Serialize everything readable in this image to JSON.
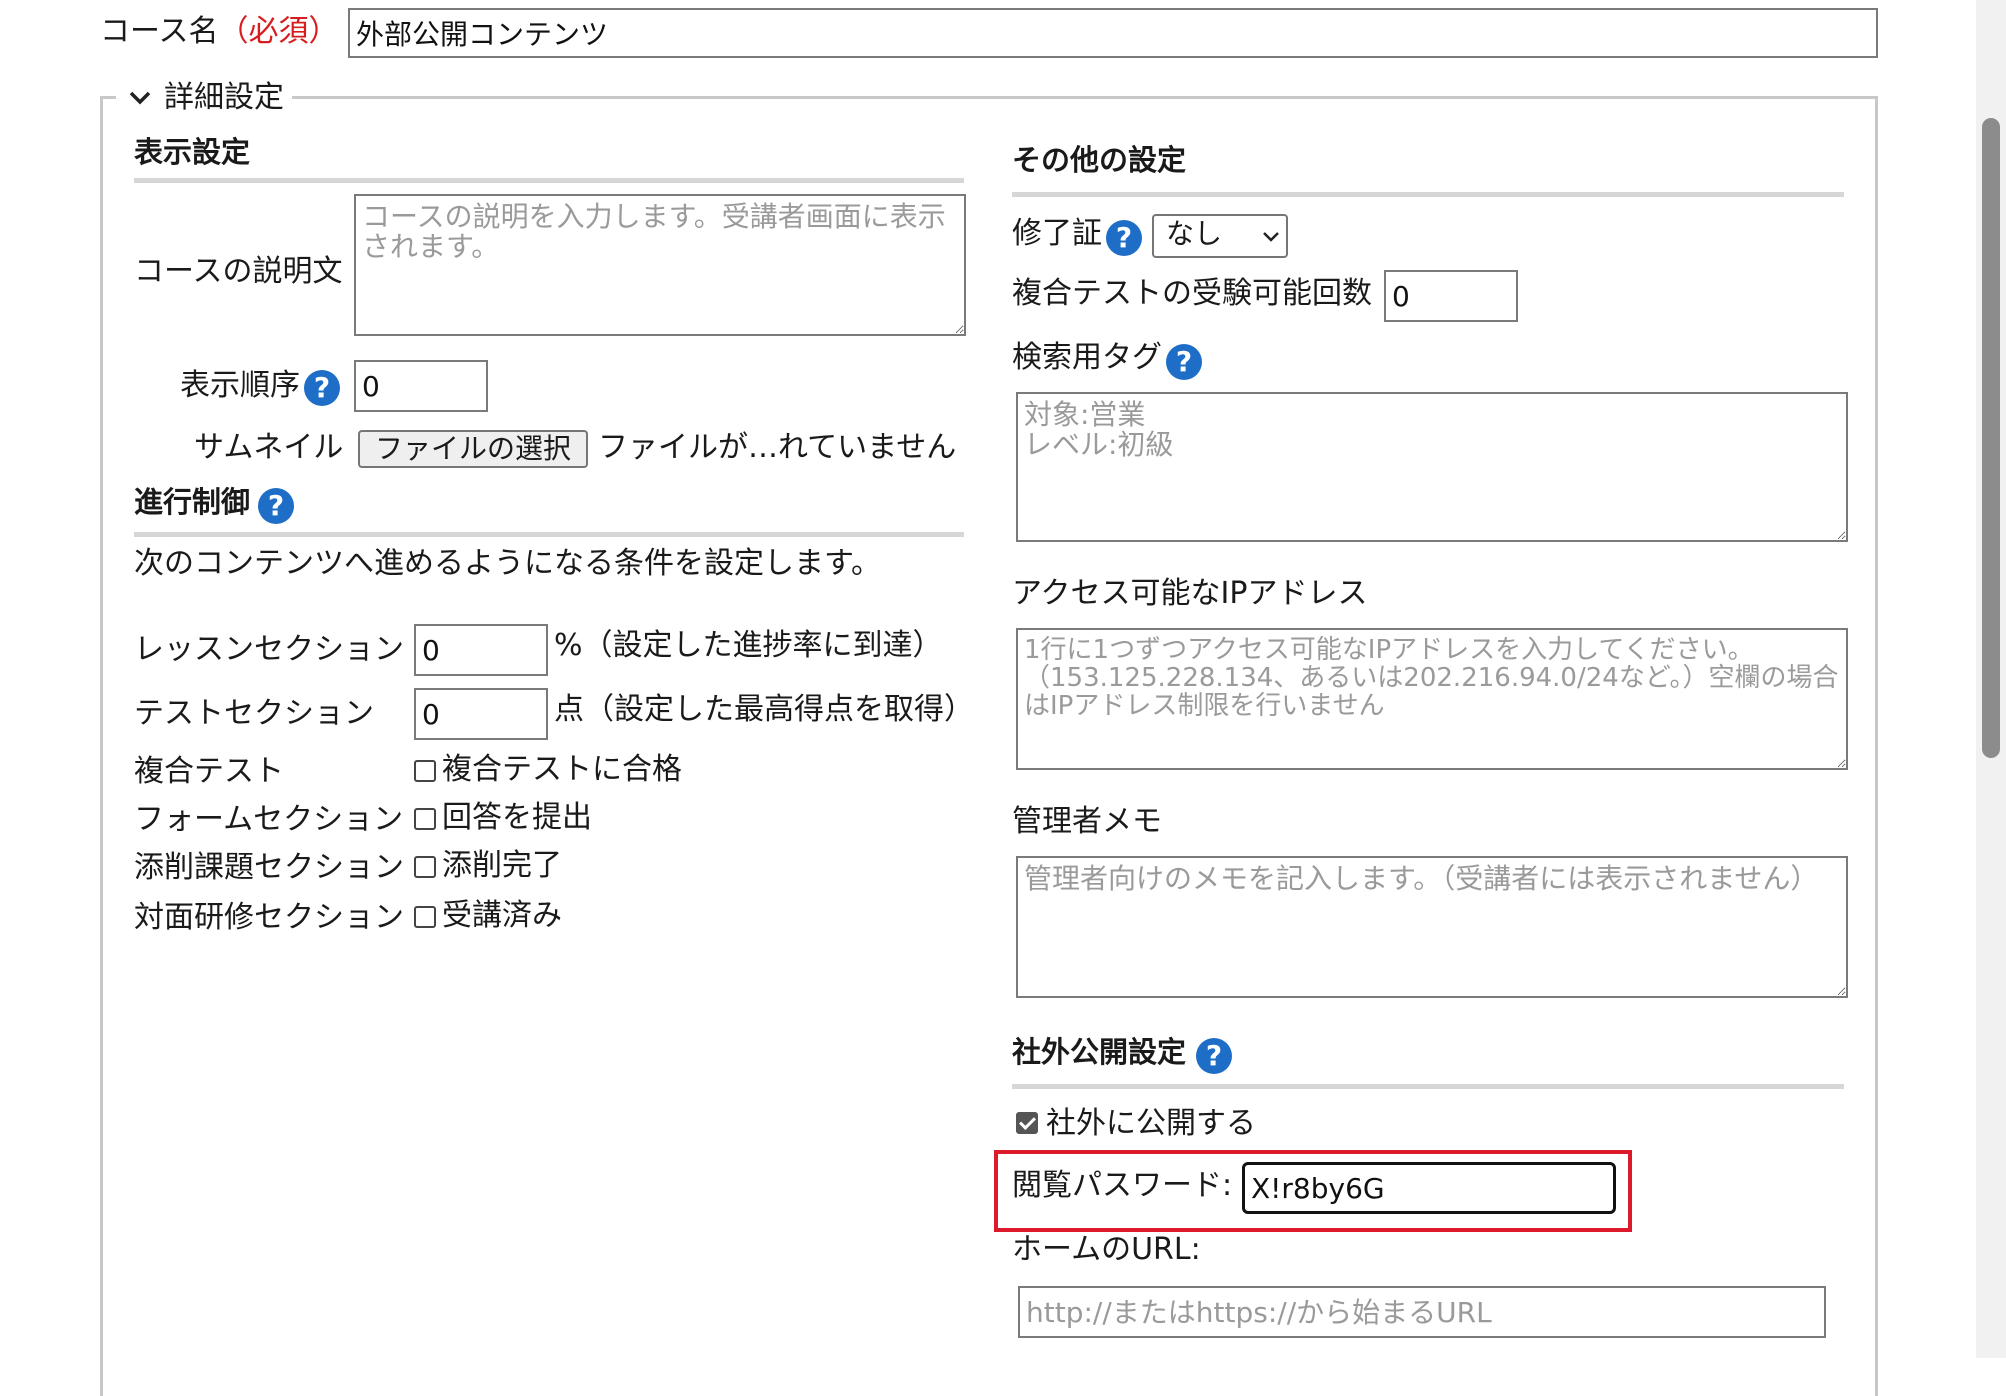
{
  "course_name": {
    "label": "コース名",
    "required": "（必須）",
    "value": "外部公開コンテンツ"
  },
  "details_legend": "詳細設定",
  "display_settings": {
    "heading": "表示設定",
    "description_label": "コースの説明文",
    "description_placeholder": "コースの説明を入力します。受講者画面に表示されます。",
    "order_label": "表示順序",
    "order_value": "0",
    "thumbnail_label": "サムネイル",
    "file_button": "ファイルの選択",
    "file_status": "ファイルが…れていません"
  },
  "progress_control": {
    "heading": "進行制御",
    "description": "次のコンテンツへ進めるようになる条件を設定します。",
    "lesson_label": "レッスンセクション",
    "lesson_value": "0",
    "lesson_suffix": "%（設定した進捗率に到達）",
    "test_label": "テストセクション",
    "test_value": "0",
    "test_suffix": "点（設定した最高得点を取得）",
    "compound_label": "複合テスト",
    "compound_check": "複合テストに合格",
    "form_label": "フォームセクション",
    "form_check": "回答を提出",
    "review_label": "添削課題セクション",
    "review_check": "添削完了",
    "face_label": "対面研修セクション",
    "face_check": "受講済み"
  },
  "other_settings": {
    "heading": "その他の設定",
    "certificate_label": "修了証",
    "certificate_selected": "なし",
    "attempts_label": "複合テストの受験可能回数",
    "attempts_value": "0",
    "tags_label": "検索用タグ",
    "tags_placeholder": "対象:営業\nレベル:初級",
    "ip_label": "アクセス可能なIPアドレス",
    "ip_placeholder": "1行に1つずつアクセス可能なIPアドレスを入力してください。（153.125.228.134、あるいは202.216.94.0/24など。）空欄の場合はIPアドレス制限を行いません",
    "memo_label": "管理者メモ",
    "memo_placeholder": "管理者向けのメモを記入します。（受講者には表示されません）"
  },
  "public_settings": {
    "heading": "社外公開設定",
    "public_check": "社外に公開する",
    "password_label": "閲覧パスワード:",
    "password_value": "X!r8by6G",
    "home_url_label": "ホームのURL:",
    "home_url_placeholder": "http://またはhttps://から始まるURL"
  },
  "icons": {
    "help": "?"
  },
  "colors": {
    "required": "#d71d1d",
    "help_icon": "#1e6ec8",
    "highlight": "#dd1a2b"
  }
}
